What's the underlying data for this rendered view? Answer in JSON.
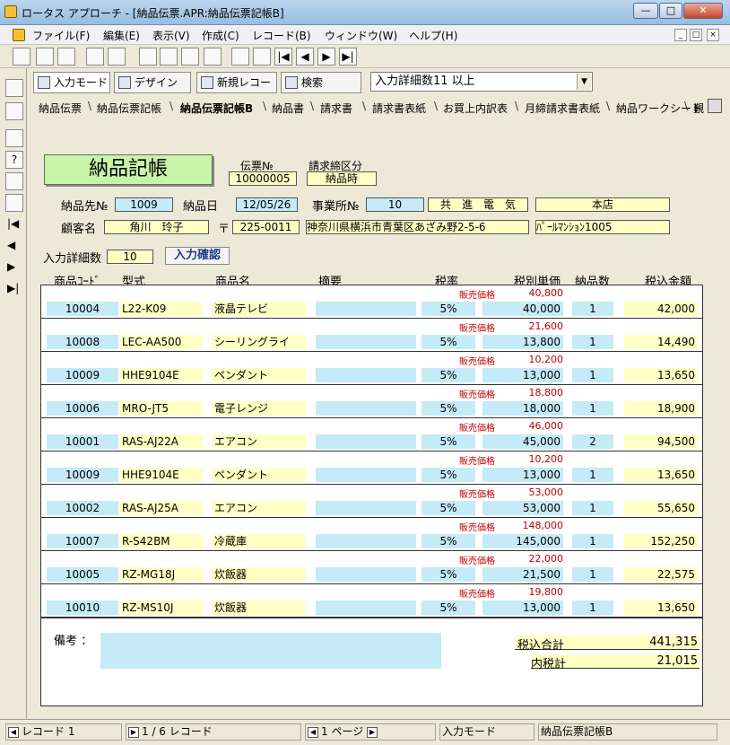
{
  "window": {
    "title": "ロータス アプローチ - [納品伝票.APR:納品伝票記帳B]"
  },
  "menu": [
    "ファイル(F)",
    "編集(E)",
    "表示(V)",
    "作成(C)",
    "レコード(B)",
    "ウィンドウ(W)",
    "ヘルプ(H)"
  ],
  "modebar": {
    "input_mode": "入力モード",
    "design": "デザイン",
    "new_record": "新規レコード",
    "search": "検索",
    "combo_value": "入力詳細数11 以上"
  },
  "tabs": [
    "納品伝票",
    "納品伝票記帳",
    "納品伝票記帳B",
    "納品書",
    "請求書",
    "請求書表紙",
    "お買上内訳表",
    "月締請求書表紙",
    "納品ワークシート",
    "覲"
  ],
  "form": {
    "title": "納品記帳",
    "slip_no_label": "伝票№",
    "slip_no": "10000005",
    "closing_label": "請求締区分",
    "closing": "納品時",
    "dest_no_label": "納品先№",
    "dest_no": "1009",
    "date_label": "納品日",
    "date": "12/05/26",
    "office_no_label": "事業所№",
    "office_no": "10",
    "company": "共　進　電　気",
    "branch": "本店",
    "customer_label": "顧客名",
    "customer": "角川　玲子",
    "postal_mark": "〒",
    "postal": "225-0011",
    "address": "神奈川県横浜市青葉区あざみ野2-5-6",
    "building": "ﾊﾟｰﾙﾏﾝｼｮﾝ1005",
    "detail_count_label": "入力詳細数",
    "detail_count": "10",
    "confirm": "入力確認",
    "notes_label": "備考 ：",
    "total_label": "税込合計",
    "total": "441,315",
    "tax_label": "内税計",
    "tax": "21,015"
  },
  "columns": [
    "商品ｺｰﾄﾞ",
    "型式",
    "商品名",
    "摘要",
    "税率",
    "税別単価",
    "納品数",
    "税込金額"
  ],
  "price_tag": "販売価格",
  "rows": [
    {
      "code": "10004",
      "model": "L22-K09",
      "name": "液晶テレビ",
      "note": "",
      "tax": "5%",
      "list": "40,800",
      "unit": "40,000",
      "qty": "1",
      "amount": "42,000"
    },
    {
      "code": "10008",
      "model": "LEC-AA500",
      "name": "シーリングライ",
      "note": "",
      "tax": "5%",
      "list": "21,600",
      "unit": "13,800",
      "qty": "1",
      "amount": "14,490"
    },
    {
      "code": "10009",
      "model": "HHE9104E",
      "name": "ペンダント",
      "note": "",
      "tax": "5%",
      "list": "10,200",
      "unit": "13,000",
      "qty": "1",
      "amount": "13,650"
    },
    {
      "code": "10006",
      "model": "MRO-JT5",
      "name": "電子レンジ",
      "note": "",
      "tax": "5%",
      "list": "18,800",
      "unit": "18,000",
      "qty": "1",
      "amount": "18,900"
    },
    {
      "code": "10001",
      "model": "RAS-AJ22A",
      "name": "エアコン",
      "note": "",
      "tax": "5%",
      "list": "46,000",
      "unit": "45,000",
      "qty": "2",
      "amount": "94,500"
    },
    {
      "code": "10009",
      "model": "HHE9104E",
      "name": "ペンダント",
      "note": "",
      "tax": "5%",
      "list": "10,200",
      "unit": "13,000",
      "qty": "1",
      "amount": "13,650"
    },
    {
      "code": "10002",
      "model": "RAS-AJ25A",
      "name": "エアコン",
      "note": "",
      "tax": "5%",
      "list": "53,000",
      "unit": "53,000",
      "qty": "1",
      "amount": "55,650"
    },
    {
      "code": "10007",
      "model": "R-S42BM",
      "name": "冷蔵庫",
      "note": "",
      "tax": "5%",
      "list": "148,000",
      "unit": "145,000",
      "qty": "1",
      "amount": "152,250"
    },
    {
      "code": "10005",
      "model": "RZ-MG18J",
      "name": "炊飯器",
      "note": "",
      "tax": "5%",
      "list": "22,000",
      "unit": "21,500",
      "qty": "1",
      "amount": "22,575"
    },
    {
      "code": "10010",
      "model": "RZ-MS10J",
      "name": "炊飯器",
      "note": "",
      "tax": "5%",
      "list": "19,800",
      "unit": "13,000",
      "qty": "1",
      "amount": "13,650"
    }
  ],
  "status": {
    "record": "レコード 1",
    "count": "1 / 6 レコード",
    "page": "1 ページ",
    "mode": "入力モード",
    "view": "納品伝票記帳B"
  }
}
